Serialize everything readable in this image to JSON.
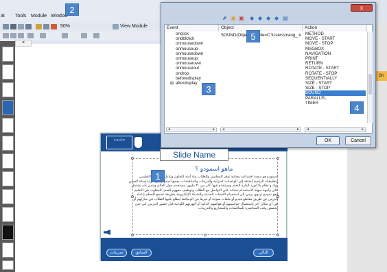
{
  "menu": [
    "at",
    "Tools",
    "Module",
    "Window"
  ],
  "toolbar": {
    "zoom": "50%",
    "view_module": "View Module"
  },
  "left_panel": {
    "tab": "×"
  },
  "right_panel": {
    "button": "Sh"
  },
  "slide": {
    "logo_text": "جـامـعـة",
    "slide_name": "Slide Name",
    "heading": "ماهو اسمودو ؟",
    "body": "اسمودو هو منصة اجتماعية مجانية توفر للمعلمين والطلاب بيئة آمنة للتعاون وتبادل المحتوى التعليمي وتطبيقاته الرقمية إضافة إلى الواجبات المنزلية والدرجات والمناقشات. يجمع اسمودو بين مزايا شبكة الفيس بوك و نظام بلاكبورد لإدارة التعلم ويستخدم فيها أكثر من ٣٠ مليون مستخدم حول العالم ويتميز بأنه يشتمل على واجهة سهلة الاستخدام تساعد على التواصل مع الطلاب وتوظيف مفهوم الصف المقلوب في التعليم وهو نموذج تربوي يرمي إلى استخدام التقنيات الحديثة والشبكة الإلكترونية بطريقة تسمح للمعلم بإعداد الدرس عن طريق مقاطع فيديو أو ملفات صوتية أو غيرها من الوسائط ليطلع عليها الطلاب في منازلهم أو في أي مكان آخر باستعمال حواسيبهم أو هواتفهم الذكية أو أجهزتهم اللوحية قبل حضور الدرس. في حين يخصص وقت المحاضرة للمناقشات والمشاريع والتدريبات.",
    "buttons": {
      "next": "التالي",
      "prev": "السابق",
      "activities": "تمرينات"
    }
  },
  "dialog": {
    "close": "x",
    "columns": {
      "event": "Event",
      "object": "Object",
      "action": "Action"
    },
    "events": [
      "onclick",
      "ondblclick",
      "onmousedown",
      "onmouseup",
      "onmousedown",
      "onmouseup",
      "onmouseover",
      "onmouseout",
      "ondrop",
      "beforedisplay",
      "afterdisplay"
    ],
    "object_value": "SOUND(Obje... 1\", File=C:\\Users\\mang_ tom...",
    "actions": [
      "METHOD",
      "MOVE - START",
      "MOVE - STOP",
      "MSGBOX",
      "NAVIGATION",
      "PRINT",
      "RETURN",
      "ROTATE - START",
      "ROTATE - STOP",
      "SEQUENTIALLY",
      "SIZE - START",
      "SIZE - STOP",
      "SOUND",
      "PARALLEL",
      "TIMER"
    ],
    "selected_action": "SOUND",
    "ok": "OK",
    "cancel": "Cancel"
  },
  "badges": [
    "1",
    "2",
    "3",
    "4",
    "5"
  ]
}
